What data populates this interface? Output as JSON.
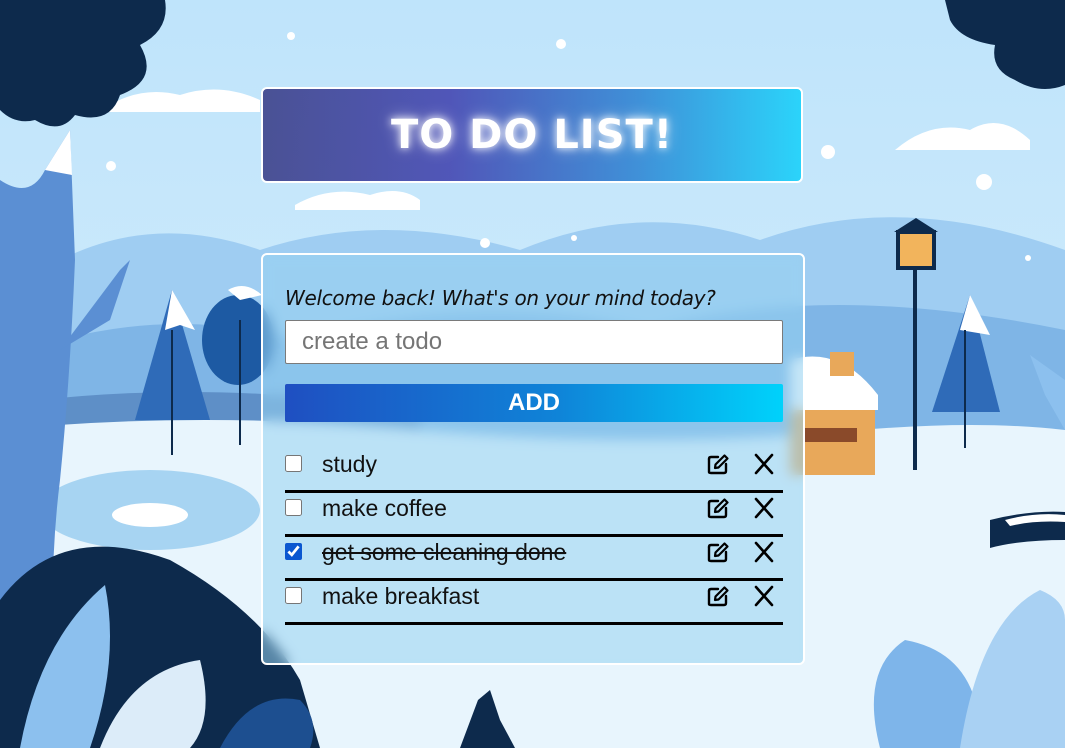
{
  "header": {
    "title": "TO DO LIST!"
  },
  "form": {
    "welcome": "Welcome back! What's on your mind today?",
    "input_placeholder": "create a todo",
    "input_value": "",
    "add_label": "ADD"
  },
  "todos": [
    {
      "text": "study",
      "checked": false
    },
    {
      "text": "make coffee",
      "checked": false
    },
    {
      "text": "get some cleaning done",
      "checked": true
    },
    {
      "text": "make breakfast",
      "checked": false
    }
  ],
  "icons": {
    "edit": "edit-icon",
    "delete": "close-icon"
  },
  "colors": {
    "add_gradient_start": "#1f4fc1",
    "add_gradient_end": "#00d2fb",
    "checkbox": "#0b57d0",
    "row_border": "#000000"
  }
}
